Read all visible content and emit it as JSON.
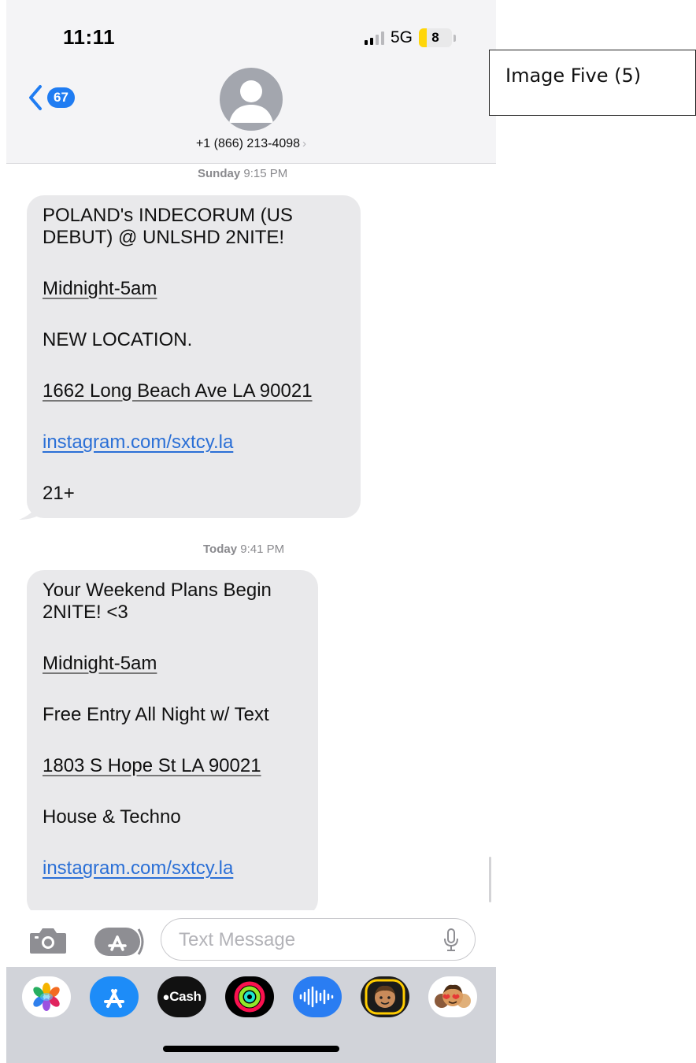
{
  "status": {
    "time": "11:11",
    "network": "5G",
    "battery": "8"
  },
  "header": {
    "back_badge": "67",
    "contact": "+1 (866) 213-4098"
  },
  "thread": [
    {
      "timestamp_day": "Sunday",
      "timestamp_time": "9:15 PM",
      "lines": [
        "POLAND's INDECORUM (US DEBUT) @ UNLSHD 2NITE!",
        "Midnight-5am",
        "NEW LOCATION.",
        "1662 Long Beach Ave LA 90021",
        "instagram.com/sxtcy.la",
        "21+"
      ]
    },
    {
      "timestamp_day": "Today",
      "timestamp_time": "9:41 PM",
      "lines": [
        "Your Weekend Plans Begin 2NITE! <3",
        "Midnight-5am",
        "Free Entry All Night w/ Text",
        "1803 S Hope St LA 90021",
        "House & Techno",
        "instagram.com/sxtcy.la"
      ]
    }
  ],
  "composer": {
    "placeholder": "Text Message"
  },
  "app_tray": {
    "apps": [
      "photos-icon",
      "app-store-icon",
      "cash-app-icon",
      "fitness-icon",
      "voice-memo-icon",
      "memoji-icon",
      "animoji-stickers-icon"
    ],
    "cash_label": "Cash"
  },
  "annotation": {
    "label": "Image Five (5)"
  },
  "colors": {
    "link": "#2a6fd6",
    "badge": "#1f7cf2",
    "bubble": "#e9e9eb",
    "battery_fill": "#ffd60a"
  }
}
